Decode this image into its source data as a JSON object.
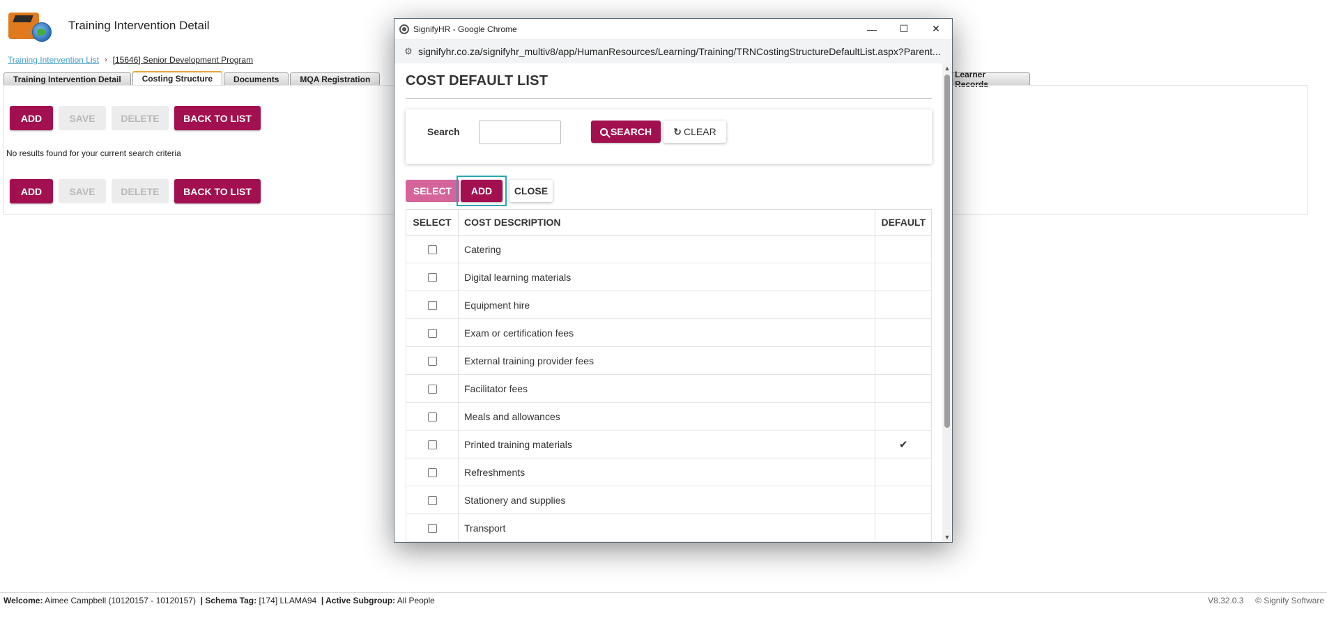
{
  "app": {
    "page_title": "Training Intervention Detail"
  },
  "breadcrumb": {
    "list_link": "Training Intervention List",
    "separator": "›",
    "current": "[15646] Senior Development Program"
  },
  "tabs": [
    {
      "label": "Training Intervention Detail",
      "active": false
    },
    {
      "label": "Costing Structure",
      "active": true
    },
    {
      "label": "Documents",
      "active": false
    },
    {
      "label": "MQA Registration",
      "active": false
    },
    {
      "label": "Learner Records",
      "active": false
    }
  ],
  "toolbar": {
    "add": "ADD",
    "save": "SAVE",
    "delete": "DELETE",
    "back": "BACK TO LIST"
  },
  "no_results": "No results found for your current search criteria",
  "footer": {
    "welcome_label": "Welcome:",
    "welcome_value": "Aimee Campbell (10120157 - 10120157)",
    "schema_label": "| Schema Tag:",
    "schema_value": "[174] LLAMA94",
    "subgroup_label": "| Active Subgroup:",
    "subgroup_value": "All People",
    "version": "V8.32.0.3",
    "copyright": "© Signify Software"
  },
  "popup": {
    "window_title": "SignifyHR - Google Chrome",
    "url": "signifyhr.co.za/signifyhr_multiv8/app/HumanResources/Learning/Training/TRNCostingStructureDefaultList.aspx?Parent...",
    "heading": "COST DEFAULT LIST",
    "search_label": "Search",
    "search_value": "",
    "search_button": "SEARCH",
    "clear_button": "CLEAR",
    "select_button": "SELECT",
    "add_button": "ADD",
    "close_button": "CLOSE",
    "columns": {
      "select": "SELECT",
      "description": "COST DESCRIPTION",
      "default": "DEFAULT"
    },
    "rows": [
      {
        "description": "Catering",
        "checked": false,
        "default": false
      },
      {
        "description": "Digital learning materials",
        "checked": false,
        "default": false
      },
      {
        "description": "Equipment hire",
        "checked": false,
        "default": false
      },
      {
        "description": "Exam or certification fees",
        "checked": false,
        "default": false
      },
      {
        "description": "External training provider fees",
        "checked": false,
        "default": false
      },
      {
        "description": "Facilitator fees",
        "checked": false,
        "default": false
      },
      {
        "description": "Meals and allowances",
        "checked": false,
        "default": false
      },
      {
        "description": "Printed training materials",
        "checked": false,
        "default": true
      },
      {
        "description": "Refreshments",
        "checked": false,
        "default": false
      },
      {
        "description": "Stationery and supplies",
        "checked": false,
        "default": false
      },
      {
        "description": "Transport",
        "checked": false,
        "default": false
      }
    ]
  },
  "colors": {
    "brand": "#a3104f",
    "select_pink": "#d4649a",
    "focus_outline": "#2aa5b4",
    "link": "#4aa0c8",
    "active_tab_accent": "#e9a23a"
  }
}
